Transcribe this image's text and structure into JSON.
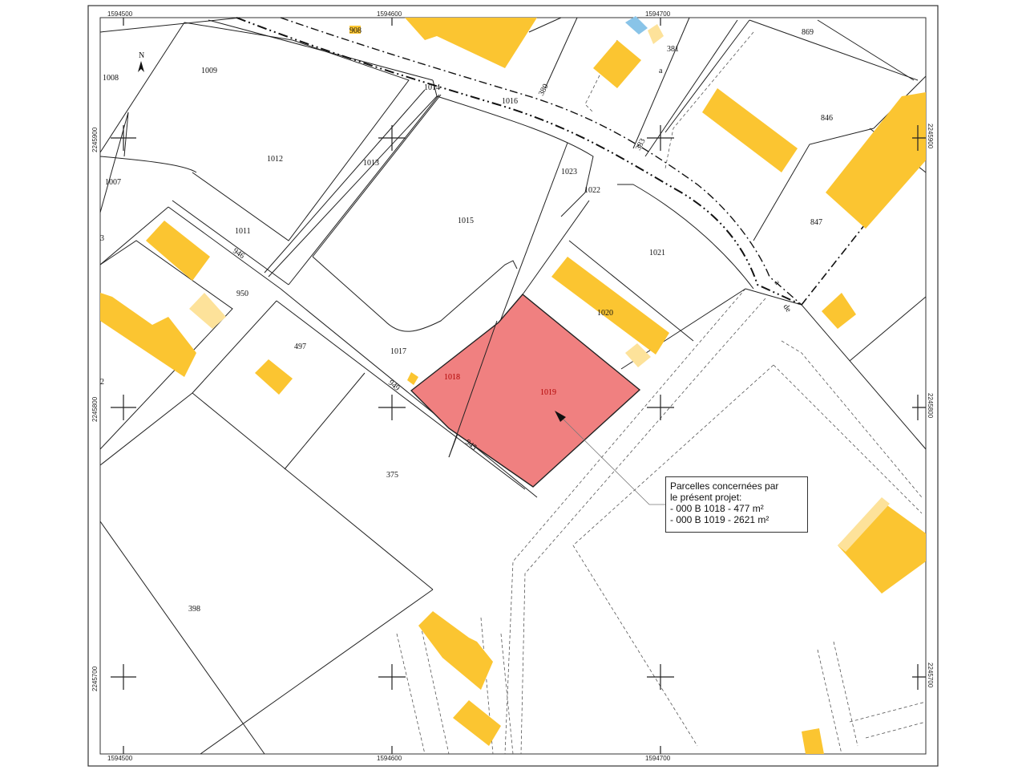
{
  "map": {
    "coords_x": [
      "1594500",
      "1594600",
      "1594700"
    ],
    "coords_y": [
      "2245900",
      "2245800",
      "2245700"
    ],
    "north": "N",
    "parcels": {
      "p1008": "1008",
      "p1009": "1009",
      "p1007": "1007",
      "p1012": "1012",
      "p1013": "1013",
      "p1014": "1014",
      "p1016": "1016",
      "p380": "380",
      "p381": "381",
      "pa": "a",
      "p869": "869",
      "p846": "846",
      "p847": "847",
      "p1023": "1023",
      "p1022": "1022",
      "p1015": "1015",
      "p1011": "1011",
      "p946": "946",
      "p950": "950",
      "p1021": "1021",
      "p1020": "1020",
      "p497": "497",
      "p1017": "1017",
      "p1018": "1018",
      "p1019": "1019",
      "p949": "949",
      "p945": "945",
      "p375": "375",
      "p398": "398",
      "p383": "383",
      "p908": "908",
      "pde": "de",
      "pa2": "a",
      "p3": "3",
      "p2": "2"
    },
    "highlight_color": "#f08080"
  },
  "legend": {
    "line1": "Parcelles concernées par",
    "line2": "le présent projet:",
    "line3": "- 000 B 1018 - 477 m²",
    "line4": "- 000 B 1019 - 2621 m²"
  }
}
